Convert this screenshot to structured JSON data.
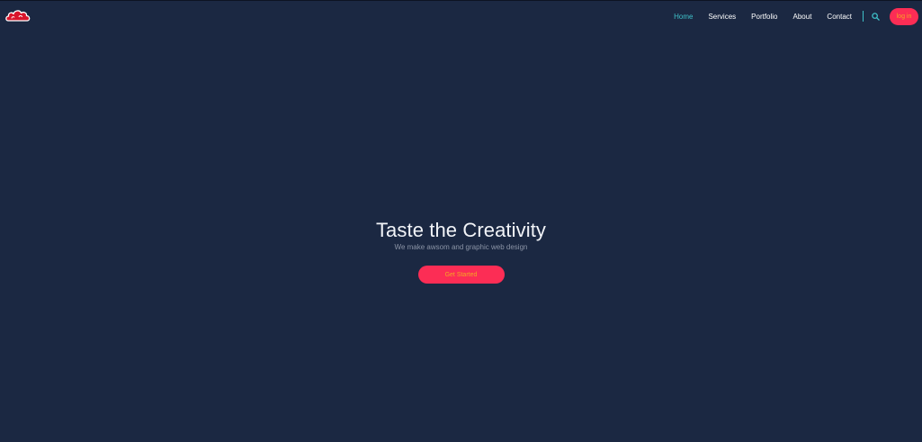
{
  "header": {
    "logo_icon": "red-cloud-logo-icon",
    "nav": [
      {
        "label": "Home",
        "active": true
      },
      {
        "label": "Services",
        "active": false
      },
      {
        "label": "Portfolio",
        "active": false
      },
      {
        "label": "About",
        "active": false
      },
      {
        "label": "Contact",
        "active": false
      }
    ],
    "search_icon": "search-icon",
    "login_label": "log in"
  },
  "hero": {
    "title": "Taste the Creativity",
    "subtitle": "We make awsom and graphic web design",
    "cta_label": "Get Started"
  },
  "colors": {
    "background": "#1b2842",
    "accent": "#fc2d55",
    "active_nav": "#3fc1c9",
    "button_text": "#f5a623"
  }
}
